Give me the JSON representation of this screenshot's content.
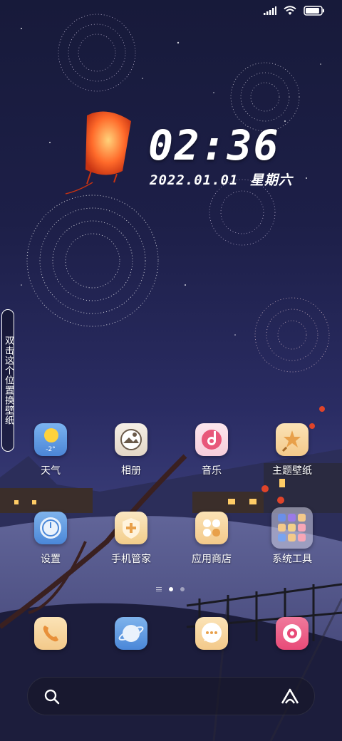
{
  "status_bar": {
    "signal_icon": "signal-icon",
    "wifi_icon": "wifi-icon",
    "battery_icon": "battery-icon",
    "battery_level": 0.9
  },
  "lock_clock": {
    "time": "02:36",
    "date": "2022.01.01",
    "weekday": "星期六"
  },
  "side_tab": {
    "label": "双击这个位置换壁纸"
  },
  "apps_row1": [
    {
      "label": "天气",
      "icon": "weather-icon",
      "temp": "-2°"
    },
    {
      "label": "相册",
      "icon": "gallery-icon"
    },
    {
      "label": "音乐",
      "icon": "music-icon"
    },
    {
      "label": "主题壁纸",
      "icon": "theme-icon"
    }
  ],
  "apps_row2": [
    {
      "label": "设置",
      "icon": "settings-icon"
    },
    {
      "label": "手机管家",
      "icon": "security-icon"
    },
    {
      "label": "应用商店",
      "icon": "app-store-icon"
    },
    {
      "label": "系统工具",
      "icon": "folder-icon"
    }
  ],
  "page_indicator": {
    "pages": 2,
    "current": 1
  },
  "dock": [
    {
      "name": "phone",
      "icon": "phone-icon"
    },
    {
      "name": "browser",
      "icon": "browser-icon"
    },
    {
      "name": "messages",
      "icon": "messages-icon"
    },
    {
      "name": "camera",
      "icon": "camera-icon"
    }
  ],
  "search": {
    "search_icon": "search-icon",
    "assistant_icon": "assistant-icon"
  },
  "colors": {
    "lantern": "#ff6a2a",
    "background": "#1d1f48",
    "music": "#e8577a",
    "camera": "#e84a78"
  }
}
